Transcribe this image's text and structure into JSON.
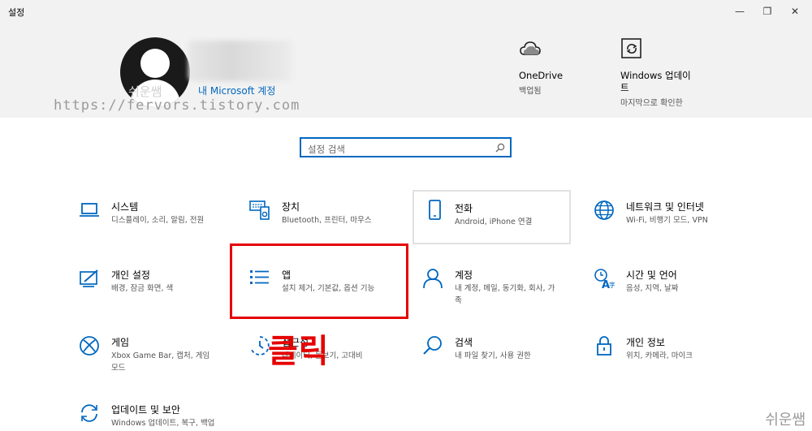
{
  "window": {
    "title": "설정",
    "minimize": "—",
    "maximize": "❐",
    "close": "✕"
  },
  "header": {
    "account_link": "내 Microsoft 계정",
    "avatar_watermark": "쉬운쌤",
    "watermark_url": "https://fervors.tistory.com",
    "onedrive": {
      "name": "OneDrive",
      "status": "백업됨",
      "icon": "cloud-icon"
    },
    "windows_update": {
      "name": "Windows 업데이트",
      "status": "마지막으로 확인한",
      "icon": "update-icon"
    }
  },
  "search": {
    "placeholder": "설정 검색"
  },
  "tiles": [
    {
      "title": "시스템",
      "subtitle": "디스플레이, 소리, 알림, 전원",
      "icon": "laptop-icon"
    },
    {
      "title": "장치",
      "subtitle": "Bluetooth, 프린터, 마우스",
      "icon": "devices-icon"
    },
    {
      "title": "전화",
      "subtitle": "Android, iPhone 연결",
      "icon": "phone-icon"
    },
    {
      "title": "네트워크 및 인터넷",
      "subtitle": "Wi-Fi, 비행기 모드, VPN",
      "icon": "globe-icon"
    },
    {
      "title": "개인 설정",
      "subtitle": "배경, 잠금 화면, 색",
      "icon": "personalization-icon"
    },
    {
      "title": "앱",
      "subtitle": "설치 제거, 기본값, 옵션 기능",
      "icon": "apps-list-icon"
    },
    {
      "title": "계정",
      "subtitle": "내 계정, 메일, 동기화, 회사, 가족",
      "icon": "person-icon"
    },
    {
      "title": "시간 및 언어",
      "subtitle": "음성, 지역, 날짜",
      "icon": "time-language-icon"
    },
    {
      "title": "게임",
      "subtitle": "Xbox Game Bar, 캡처, 게임 모드",
      "icon": "xbox-icon"
    },
    {
      "title": "접근성",
      "subtitle": "내레이터, 돋보기, 고대비",
      "icon": "accessibility-icon"
    },
    {
      "title": "검색",
      "subtitle": "내 파일 찾기, 사용 권한",
      "icon": "search-icon"
    },
    {
      "title": "개인 정보",
      "subtitle": "위치, 카메라, 마이크",
      "icon": "lock-icon"
    },
    {
      "title": "업데이트 및 보안",
      "subtitle": "Windows 업데이트, 복구, 백업",
      "icon": "sync-icon"
    }
  ],
  "annotation": {
    "label": "클릭",
    "color": "#e60000"
  },
  "corner_watermark": "쉬운쌤",
  "colors": {
    "accent": "#0067c0",
    "header_bg": "#f2f2f2"
  }
}
